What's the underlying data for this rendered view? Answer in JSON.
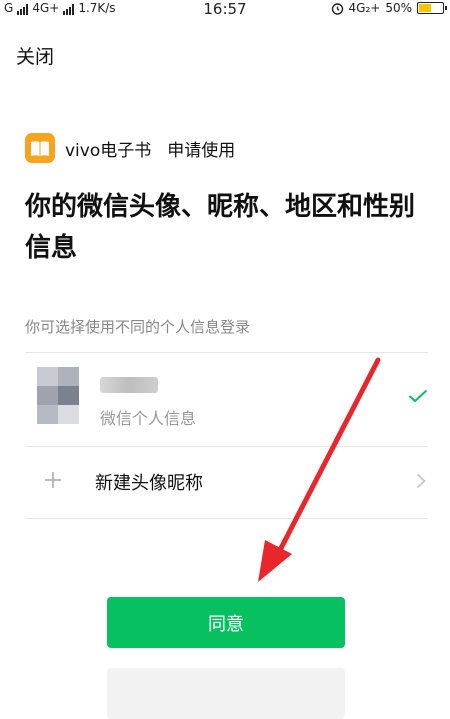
{
  "status_bar": {
    "carrier1": "G",
    "carrier2": "4G+",
    "speed": "1.7K/s",
    "time": "16:57",
    "network_right": "4G₂+",
    "battery_percent": "50%",
    "battery_level": 0.5,
    "battery_color": "#f7c600"
  },
  "header": {
    "close_label": "关闭"
  },
  "app": {
    "name": "vivo电子书",
    "action": "申请使用",
    "icon": "book-icon",
    "icon_color": "#f7a31c"
  },
  "permission_title": "你的微信头像、昵称、地区和性别信息",
  "hint": "你可选择使用不同的个人信息登录",
  "options": {
    "wechat_profile": {
      "subtitle": "微信个人信息",
      "selected": true,
      "check_icon": "check-icon"
    },
    "new_profile": {
      "label": "新建头像昵称",
      "icon": "plus-icon",
      "chevron": "chevron-right-icon"
    }
  },
  "buttons": {
    "agree_label": "同意",
    "agree_color": "#07c160"
  },
  "annotation": {
    "icon": "red-arrow-icon",
    "color": "#e8262b"
  }
}
